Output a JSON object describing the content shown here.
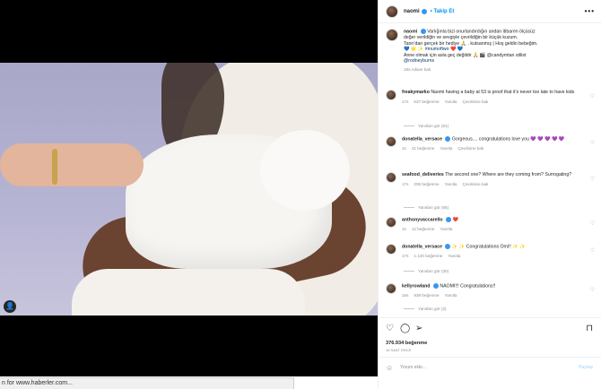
{
  "header": {
    "username": "naomi",
    "follow": "Takip Et",
    "more": "•••"
  },
  "caption": {
    "username": "naomi",
    "lines": [
      "Varlığınla bizi onurlandırdığın andan itibaren ölçüsüz",
      "değer verildiğin ve sevgiyle çevrildiğin bir küçük kuzum.",
      "Tanrı'dan gerçek bir hediye 🙏 . kutsanmış | Hoş geldin bebeğim.",
      "💙 🌟 ✨ #mumoftwo ❤️ 💙",
      "Anne olmak için asla geç değildir 🙏 🎬 @candymtan stilist",
      "@rodneyburns"
    ],
    "meta": "18s  Adave bak"
  },
  "comments": [
    {
      "user": "freakymarko",
      "verified": false,
      "text": "Naomi having a baby at 53 is proof that it's never too late to have kids",
      "time": "17s",
      "likes": "637 beğenme",
      "reply": "Yanıtla",
      "translate": "Çevirisine bak",
      "replies": "Yanıtları gör (81)"
    },
    {
      "user": "donatella_versace",
      "verified": true,
      "text": "Gorgeous.... congratulations love you 💜 💜 💜 💜 💜",
      "time": "1s",
      "likes": "41 beğenme",
      "reply": "Yanıtla",
      "translate": "Çevirisine bak",
      "replies": ""
    },
    {
      "user": "seafood_deliveries",
      "verified": false,
      "text": "The second one? Where are they coming from? Surrogating?",
      "time": "17s",
      "likes": "206 beğenme",
      "reply": "Yanıtla",
      "translate": "Çevirisine bak",
      "replies": "Yanıtları gör (65)"
    },
    {
      "user": "anthonyvaccarello",
      "verified": true,
      "text": "❤️",
      "time": "1s",
      "likes": "12 beğenme",
      "reply": "Yanıtla",
      "translate": "",
      "replies": ""
    },
    {
      "user": "donatella_versace",
      "verified": true,
      "text": "✨ ✨ Congratulations Omi!! ✨ ✨",
      "time": "17s",
      "likes": "1.140 beğenme",
      "reply": "Yanıtla",
      "translate": "",
      "replies": "Yanıtları gör (30)"
    },
    {
      "user": "kellyrowland",
      "verified": true,
      "text": "NAOMI!!! Congratulations!!",
      "time": "16s",
      "likes": "939 beğenme",
      "reply": "Yanıtla",
      "translate": "",
      "replies": "Yanıtları gör (2)"
    }
  ],
  "post": {
    "likes": "376.934 beğenme",
    "date": "16 SAAT ÖNCE"
  },
  "add_comment": {
    "placeholder": "Yorum ekle...",
    "share": "Paylaş"
  },
  "status_bar": {
    "text": "n for www.haberler.com..."
  },
  "icons": {
    "like": "heart-icon",
    "comment": "comment-icon",
    "share": "send-icon",
    "save": "bookmark-icon",
    "emoji": "smile-icon",
    "tag": "user-tag-icon",
    "more": "more-icon",
    "verified": "verified-badge-icon"
  }
}
